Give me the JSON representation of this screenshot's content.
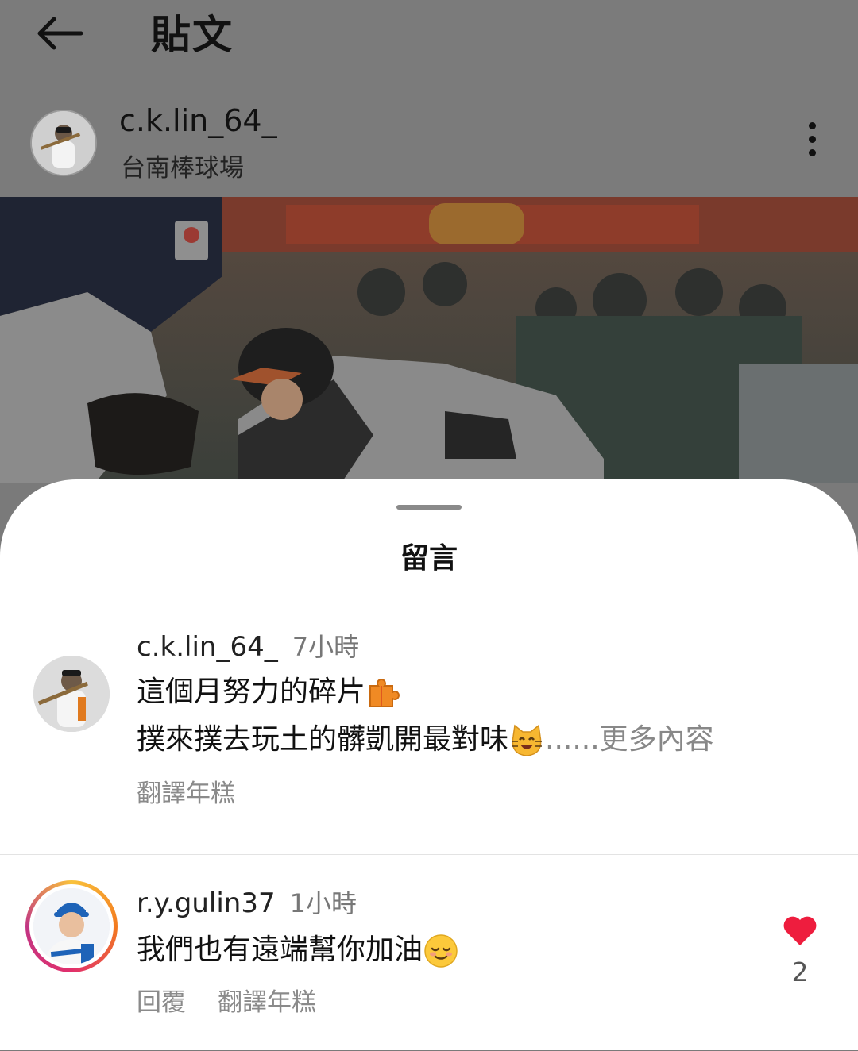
{
  "header": {
    "title": "貼文",
    "back_icon": "back-arrow-icon",
    "menu_icon": "more-vertical-icon"
  },
  "post": {
    "username": "c.k.lin_64_",
    "location": "台南棒球場"
  },
  "sheet": {
    "title": "留言"
  },
  "comments": [
    {
      "username": "c.k.lin_64_",
      "time": "7小時",
      "line1": "這個月努力的碎片",
      "line1_emoji": "puzzle-piece-icon",
      "line2": "撲來撲去玩土的髒凱開最對味",
      "line2_emoji": "smiling-cat-icon",
      "more_label": "......更多內容",
      "translate_label": "翻譯年糕"
    },
    {
      "username": "r.y.gulin37",
      "time": "1小時",
      "text": "我們也有遠端幫你加油",
      "text_emoji": "relieved-face-icon",
      "reply_label": "回覆",
      "translate_label": "翻譯年糕",
      "likes": "2",
      "liked": true
    }
  ],
  "colors": {
    "heart": "#ee1d3e",
    "story_ring": [
      "#f9c23c",
      "#f37a1f",
      "#e1306c",
      "#c13584"
    ]
  }
}
